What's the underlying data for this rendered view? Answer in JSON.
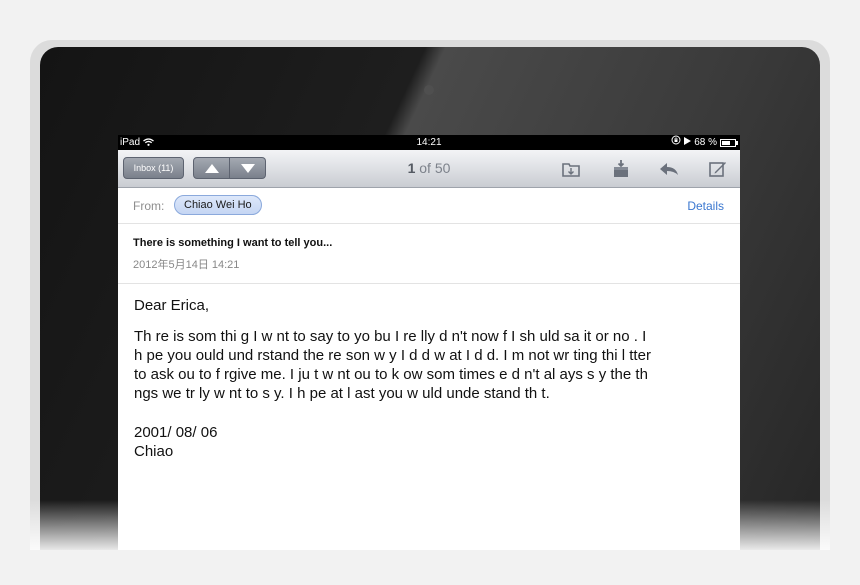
{
  "status_bar": {
    "device": "iPad",
    "time": "14:21",
    "battery": "68 %"
  },
  "toolbar": {
    "inbox_label": "Inbox (11)",
    "message_index": "1",
    "message_total_text": "of 50",
    "icons": [
      "move-folder-icon",
      "archive-icon",
      "reply-icon",
      "compose-icon"
    ]
  },
  "header": {
    "from_label": "From:",
    "sender": "Chiao Wei Ho",
    "details_label": "Details"
  },
  "message": {
    "subject": "There is something I want to tell you...",
    "date": "2012年5月14日 14:21",
    "greeting": "Dear Erica,",
    "body": "Th re is som thi g I w nt to say to yo  bu  I re lly d n't  now  f I sh uld sa  it or no . I\nh pe you  ould und rstand the re son w y I d d w at I d d. I  m not wr ting thi  l tter\nto ask  ou to f rgive me. I ju t w nt  ou to k ow som times  e d n't al ays s y the th\nngs we tr ly w nt to s y. I h pe at l ast you w uld unde stand th t.",
    "signoff_date": "2001/ 08/ 06",
    "signature": "Chiao"
  }
}
